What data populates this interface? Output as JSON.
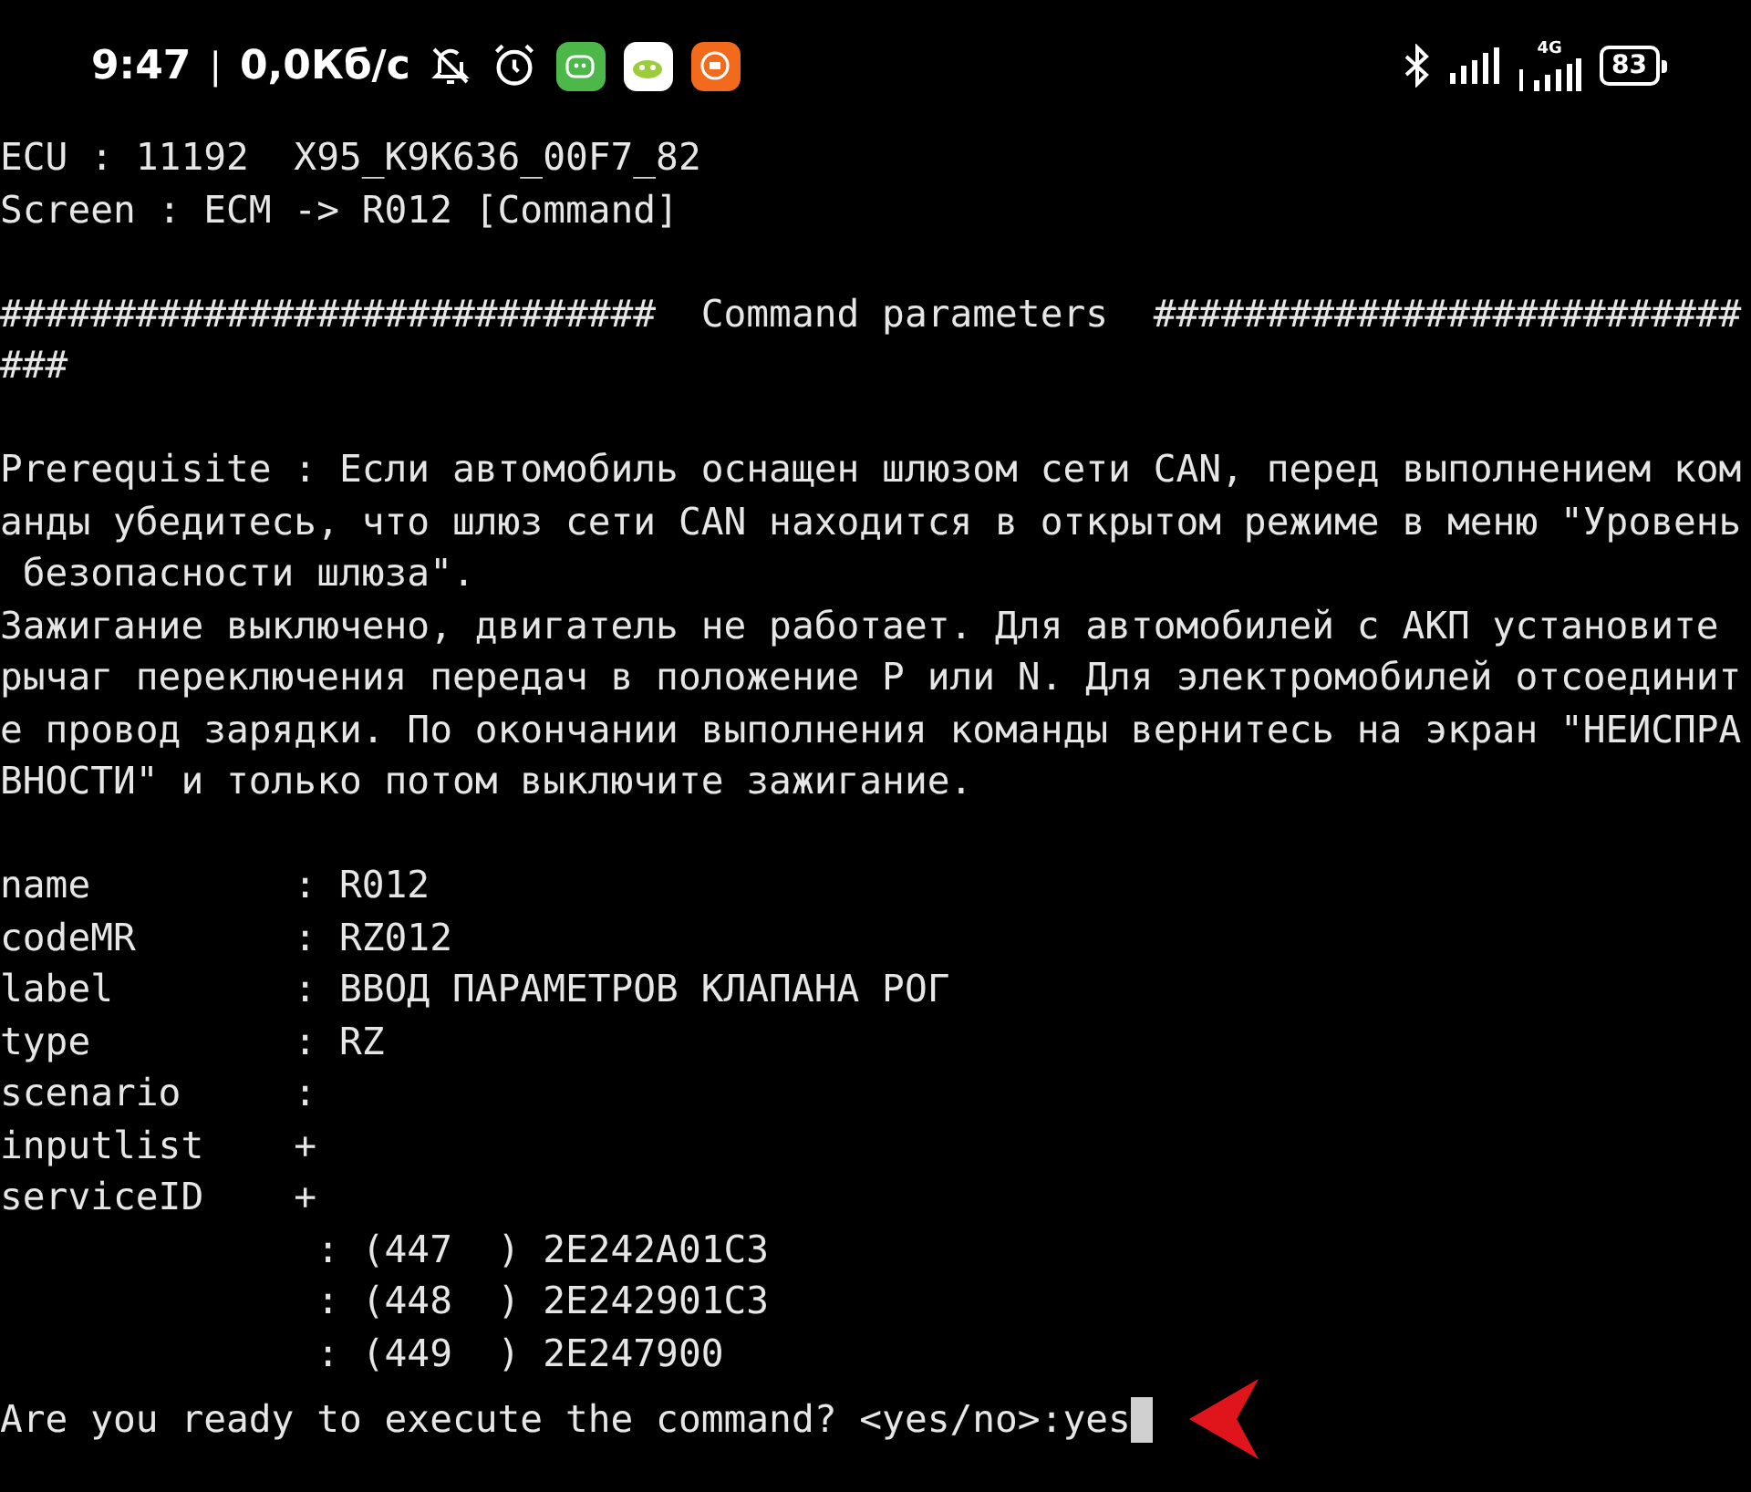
{
  "status_bar": {
    "time": "9:47",
    "separator": "|",
    "speed": "0,0Кб/с",
    "network_type": "4G",
    "battery": "83"
  },
  "terminal": {
    "blocks": [
      [
        "ECU : 11192  X95_K9K636_00F7_82",
        "Screen : ECM -> R012 [Command]"
      ],
      [
        "#############################  Command parameters  ##########################",
        "###"
      ],
      [
        "Prerequisite : Если автомобиль оснащен шлюзом сети CAN, перед выполнением ком",
        "анды убедитесь, что шлюз сети CAN находится в открытом режиме в меню \"Уровень",
        " безопасности шлюза\".",
        "Зажигание выключено, двигатель не работает. Для автомобилей с АКП установите ",
        "рычаг переключения передач в положение P или N. Для электромобилей отсоединит",
        "е провод зарядки. По окончании выполнения команды вернитесь на экран \"НЕИСПРА",
        "ВНОСТИ\" и только потом выключите зажигание."
      ],
      [
        "name         : R012",
        "codeMR       : RZ012",
        "label        : ВВОД ПАРАМЕТРОВ КЛАПАНА РОГ",
        "type         : RZ",
        "scenario     :",
        "inputlist    +",
        "serviceID    +",
        "              : (447  ) 2E242A01C3",
        "              : (448  ) 2E242901C3",
        "              : (449  ) 2E247900"
      ]
    ],
    "prompt": "Are you ready to execute the command? <yes/no>:",
    "input": "yes"
  }
}
